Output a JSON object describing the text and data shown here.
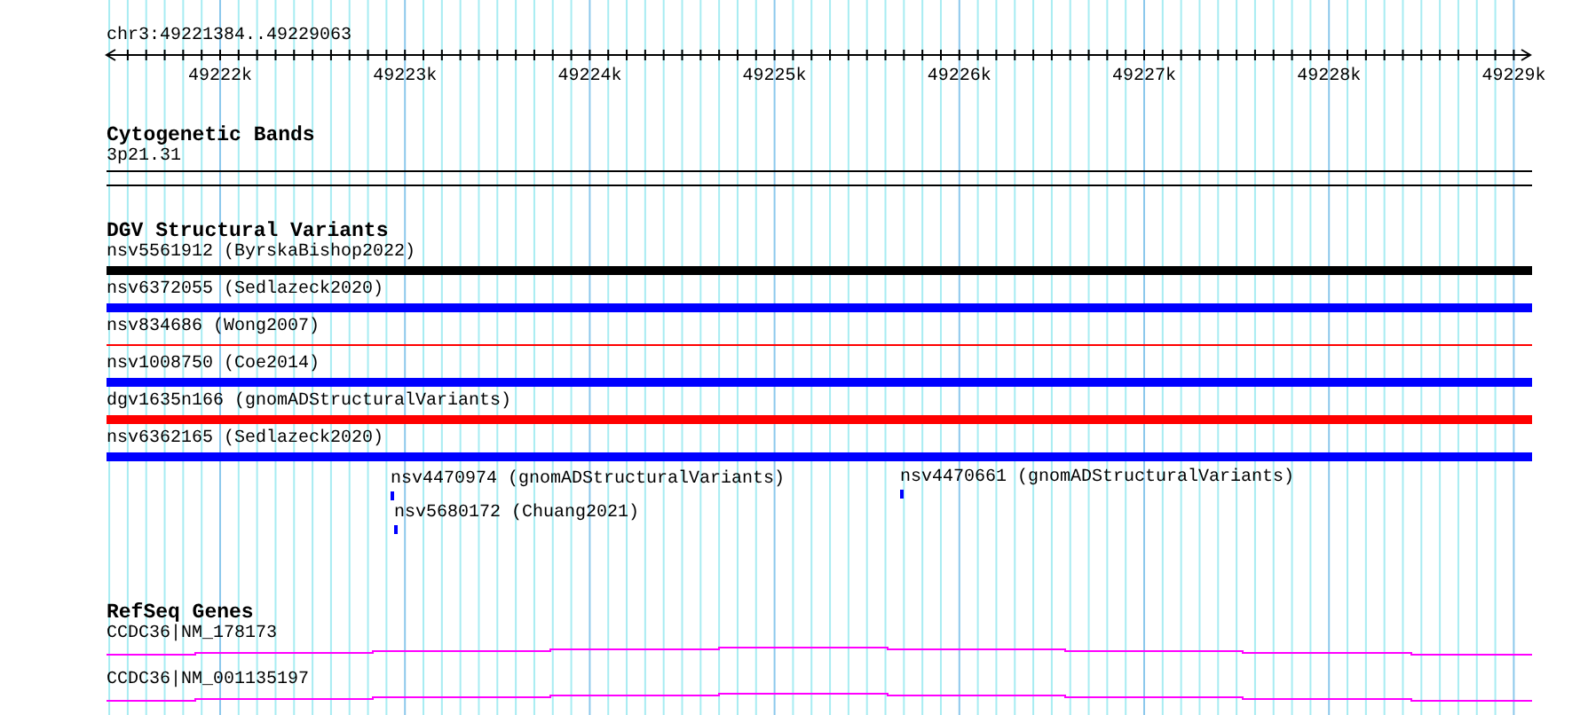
{
  "ruler": {
    "location": "chr3:49221384..49229063",
    "ticks": [
      "49222k",
      "49223k",
      "49224k",
      "49225k",
      "49226k",
      "49227k",
      "49228k",
      "49229k"
    ]
  },
  "tracks": [
    {
      "kind": "cytoband",
      "title": "Cytogenetic Bands",
      "features": [
        {
          "label": "3p21.31"
        }
      ]
    },
    {
      "kind": "variants",
      "title": "DGV Structural Variants",
      "features": [
        {
          "label": "nsv5561912 (ByrskaBishop2022)",
          "color": "#000000",
          "kind": "thick"
        },
        {
          "label": "nsv6372055 (Sedlazeck2020)",
          "color": "#0000ff",
          "kind": "thick"
        },
        {
          "label": "nsv834686 (Wong2007)",
          "color": "#ff0000",
          "kind": "thin"
        },
        {
          "label": "nsv1008750 (Coe2014)",
          "color": "#0000ff",
          "kind": "thick"
        },
        {
          "label": "dgv1635n166 (gnomADStructuralVariants)",
          "color": "#ff0000",
          "kind": "thick"
        },
        {
          "label": "nsv6362165 (Sedlazeck2020)",
          "color": "#0000ff",
          "kind": "thick"
        },
        {
          "label": "nsv4470974 (gnomADStructuralVariants)",
          "color": "#0000ff",
          "kind": "point"
        },
        {
          "label": "nsv5680172 (Chuang2021)",
          "color": "#0000ff",
          "kind": "point"
        },
        {
          "label": "nsv4470661 (gnomADStructuralVariants)",
          "color": "#0000ff",
          "kind": "point"
        }
      ]
    },
    {
      "kind": "genes",
      "title": "RefSeq Genes",
      "features": [
        {
          "label": "CCDC36|NM_178173"
        },
        {
          "label": "CCDC36|NM_001135197"
        }
      ]
    }
  ]
}
